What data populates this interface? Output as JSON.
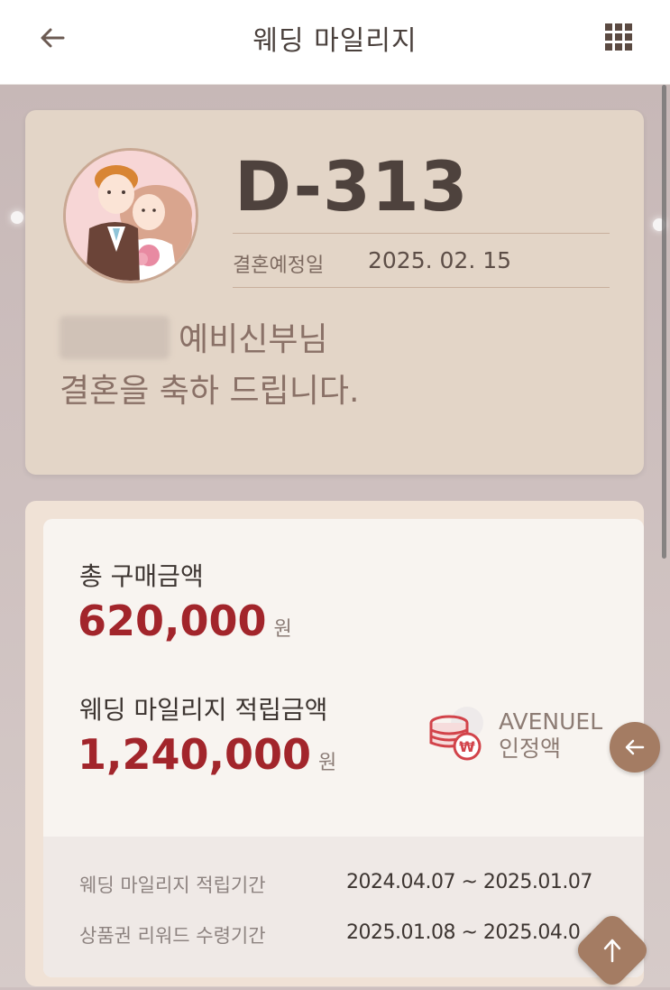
{
  "header": {
    "title": "웨딩 마일리지",
    "back_icon": "arrow-left-icon",
    "menu_icon": "grid-menu-icon"
  },
  "dday_card": {
    "dday": "D-313",
    "wedding_date_label": "결혼예정일",
    "wedding_date": "2025. 02. 15",
    "bride_title": "예비신부님",
    "congrats": "결혼을 축하 드립니다."
  },
  "amounts": {
    "total_label": "총 구매금액",
    "total_value": "620,000",
    "total_unit": "원",
    "mileage_label": "웨딩 마일리지 적립금액",
    "mileage_value": "1,240,000",
    "mileage_unit": "원",
    "avenuel_line1": "AVENUEL",
    "avenuel_line2": "인정액"
  },
  "periods": {
    "accrual_label": "웨딩 마일리지 적립기간",
    "accrual_value": "2024.04.07 ~ 2025.01.07",
    "reward_label": "상품권 리워드 수령기간",
    "reward_value": "2025.01.08 ~ 2025.04.0"
  },
  "colors": {
    "accent": "#a2252b",
    "brown": "#a47c63",
    "card": "#e3d5c7"
  }
}
